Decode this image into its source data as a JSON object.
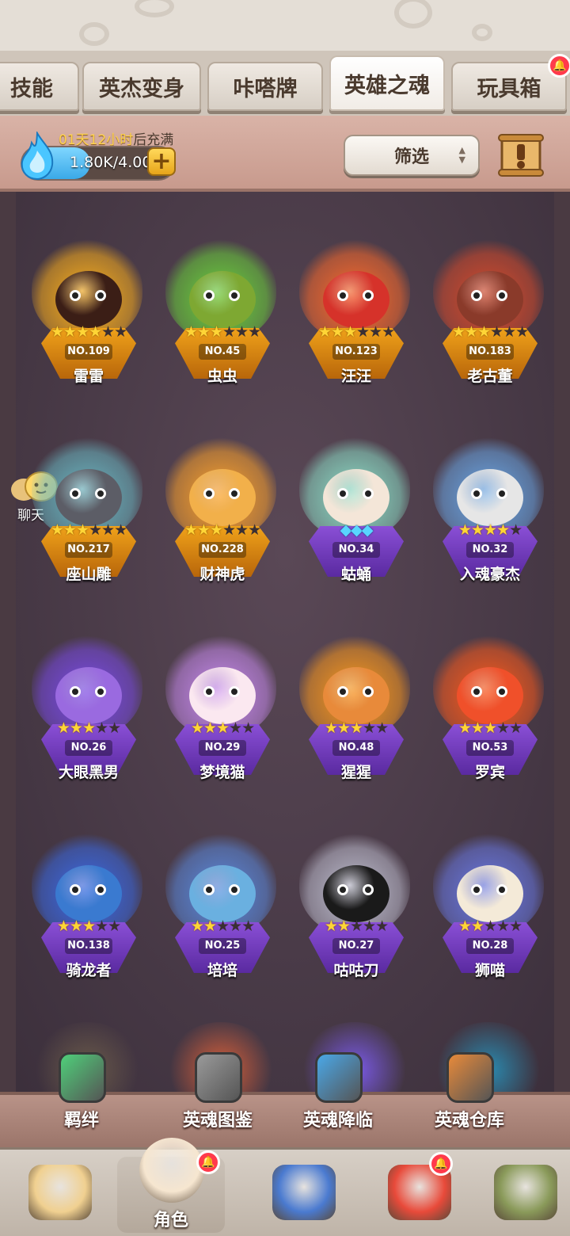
{
  "tabs": [
    {
      "label": "技能"
    },
    {
      "label": "英杰变身"
    },
    {
      "label": "咔嗒牌"
    },
    {
      "label": "英雄之魂",
      "active": true
    },
    {
      "label": "玩具箱",
      "badge": true
    }
  ],
  "resource": {
    "timer_value": "01天12小时",
    "timer_suffix": "后充满",
    "amount": "1.80K/4.00K",
    "fill_fraction": 0.45
  },
  "filter": {
    "label": "筛选"
  },
  "chat": {
    "label": "聊天"
  },
  "colors": {
    "gold_frame": "#f0a21a",
    "purple_frame": "#8a4fd6",
    "star_on": "#ffd536",
    "star_off": "#3a2f33",
    "gem": "#59d6ff",
    "badge": "#ff3a4c"
  },
  "souls": [
    {
      "name": "雷雷",
      "no": "NO.109",
      "stars": 4,
      "max": 6,
      "frame": "gold",
      "aura": "#ffb11a",
      "face": "#3b1e16"
    },
    {
      "name": "虫虫",
      "no": "NO.45",
      "stars": 3,
      "max": 6,
      "frame": "gold",
      "aura": "#6ad43a",
      "face": "#7ea832"
    },
    {
      "name": "汪汪",
      "no": "NO.123",
      "stars": 3,
      "max": 6,
      "frame": "gold",
      "aura": "#ff6a2a",
      "face": "#d6322a"
    },
    {
      "name": "老古董",
      "no": "NO.183",
      "stars": 3,
      "max": 6,
      "frame": "gold",
      "aura": "#d94a2a",
      "face": "#8a3a2a"
    },
    {
      "name": "座山雕",
      "no": "NO.217",
      "stars": 3,
      "max": 6,
      "frame": "gold",
      "aura": "#6ab9c4",
      "face": "#5c5d66"
    },
    {
      "name": "财神虎",
      "no": "NO.228",
      "stars": 3,
      "max": 6,
      "frame": "gold",
      "aura": "#ffa32a",
      "face": "#f2b04a"
    },
    {
      "name": "蛄蛹",
      "no": "NO.34",
      "stars": 3,
      "max": 3,
      "frame": "purple",
      "aura": "#8ce0c8",
      "face": "#f4e6d8",
      "gems": true
    },
    {
      "name": "入魂豪杰",
      "no": "NO.32",
      "stars": 4,
      "max": 5,
      "frame": "purple",
      "aura": "#6aa8e8",
      "face": "#e6e6e6"
    },
    {
      "name": "大眼黑男",
      "no": "NO.26",
      "stars": 3,
      "max": 5,
      "frame": "purple",
      "aura": "#7a4ae8",
      "face": "#9a6ae0"
    },
    {
      "name": "梦境猫",
      "no": "NO.29",
      "stars": 3,
      "max": 5,
      "frame": "purple",
      "aura": "#c88af0",
      "face": "#fbe8f0"
    },
    {
      "name": "猩猩",
      "no": "NO.48",
      "stars": 3,
      "max": 5,
      "frame": "purple",
      "aura": "#ff9a1a",
      "face": "#e88a3a"
    },
    {
      "name": "罗宾",
      "no": "NO.53",
      "stars": 3,
      "max": 5,
      "frame": "purple",
      "aura": "#ff5a1a",
      "face": "#f0502a"
    },
    {
      "name": "骑龙者",
      "no": "NO.138",
      "stars": 3,
      "max": 5,
      "frame": "purple",
      "aura": "#3a6ae8",
      "face": "#3a7ad0"
    },
    {
      "name": "培培",
      "no": "NO.25",
      "stars": 2,
      "max": 5,
      "frame": "purple",
      "aura": "#5a8ae0",
      "face": "#6ab0e0"
    },
    {
      "name": "咕咕刀",
      "no": "NO.27",
      "stars": 2,
      "max": 5,
      "frame": "purple",
      "aura": "#bfbfd0",
      "face": "#1a1a1a"
    },
    {
      "name": "狮喵",
      "no": "NO.28",
      "stars": 2,
      "max": 5,
      "frame": "purple",
      "aura": "#6a7ae8",
      "face": "#f4ead8"
    }
  ],
  "features": [
    {
      "label": "羁绊",
      "icon": "green-gem-icon",
      "color": "#4fd07a"
    },
    {
      "label": "英魂图鉴",
      "icon": "book-icon",
      "color": "#9a9a9a"
    },
    {
      "label": "英魂降临",
      "icon": "blue-crystal-icon",
      "color": "#4aa8e8"
    },
    {
      "label": "英魂仓库",
      "icon": "orange-crystal-icon",
      "color": "#e88a3a"
    }
  ],
  "nav": [
    {
      "label": "",
      "icon": "caveman-icon",
      "color": "#f0d090"
    },
    {
      "label": "角色",
      "icon": "hero-icon",
      "color": "#f6e6d0",
      "active": true,
      "badge": true
    },
    {
      "label": "",
      "icon": "sword-shield-icon",
      "color": "#4a7ad0"
    },
    {
      "label": "",
      "icon": "red-dragon-icon",
      "color": "#e84a3a",
      "badge": true
    },
    {
      "label": "",
      "icon": "golem-icon",
      "color": "#8a9a5a"
    }
  ]
}
